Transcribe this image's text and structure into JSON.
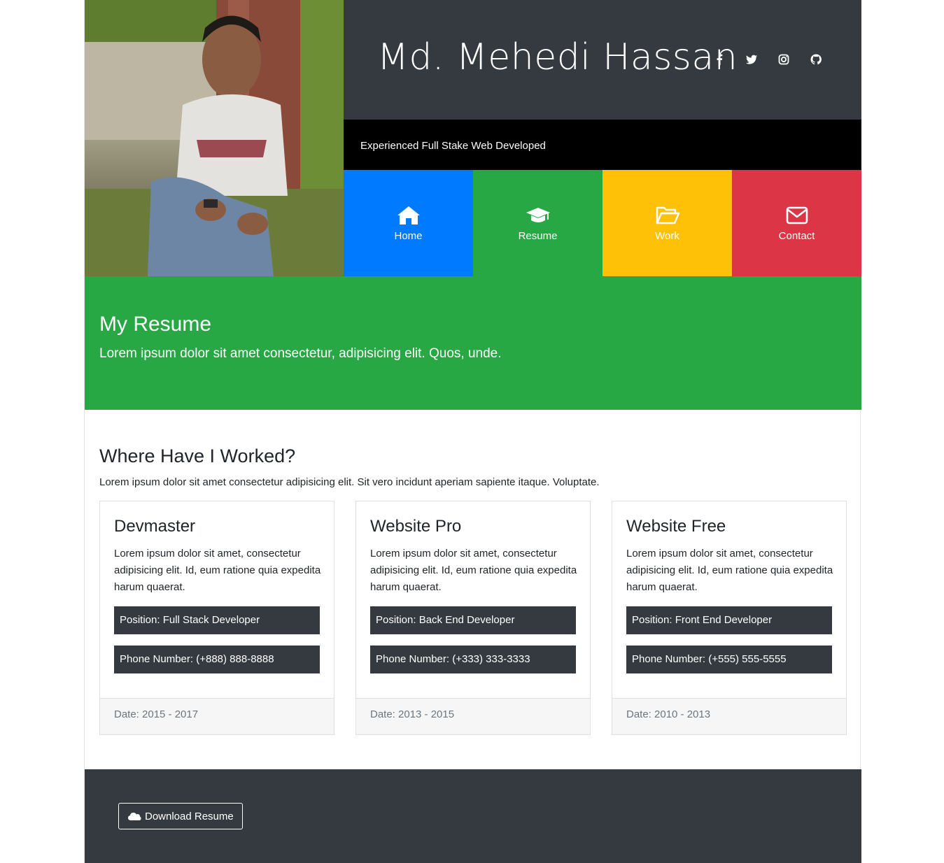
{
  "header": {
    "name": "Md. Mehedi Hassan",
    "tagline": "Experienced Full Stake Web Developed",
    "social": [
      "facebook-icon",
      "twitter-icon",
      "instagram-icon",
      "github-icon"
    ]
  },
  "nav": {
    "items": [
      {
        "label": "Home",
        "icon": "home-icon",
        "color": "#007bff"
      },
      {
        "label": "Resume",
        "icon": "graduation-cap-icon",
        "color": "#28a745"
      },
      {
        "label": "Work",
        "icon": "folder-open-icon",
        "color": "#ffc107"
      },
      {
        "label": "Contact",
        "icon": "envelope-icon",
        "color": "#dc3545"
      }
    ]
  },
  "hero": {
    "title": "My Resume",
    "subtitle": "Lorem ipsum dolor sit amet consectetur, adipisicing elit. Quos, unde."
  },
  "work": {
    "title": "Where Have I Worked?",
    "intro": "Lorem ipsum dolor sit amet consectetur adipisicing elit. Sit vero incidunt aperiam sapiente itaque. Voluptate.",
    "cards": [
      {
        "company": "Devmaster",
        "text": "Lorem ipsum dolor sit amet, consectetur adipisicing elit. Id, eum ratione quia expedita harum quaerat.",
        "position": "Position: Full Stack Developer",
        "phone": "Phone Number: (+888) 888-8888",
        "date": "Date: 2015 - 2017"
      },
      {
        "company": "Website Pro",
        "text": "Lorem ipsum dolor sit amet, consectetur adipisicing elit. Id, eum ratione quia expedita harum quaerat.",
        "position": "Position: Back End Developer",
        "phone": "Phone Number: (+333) 333-3333",
        "date": "Date: 2013 - 2015"
      },
      {
        "company": "Website Free",
        "text": "Lorem ipsum dolor sit amet, consectetur adipisicing elit. Id, eum ratione quia expedita harum quaerat.",
        "position": "Position: Front End Developer",
        "phone": "Phone Number: (+555) 555-5555",
        "date": "Date: 2010 - 2013"
      }
    ]
  },
  "footer": {
    "download_label": "Download Resume",
    "download_icon": "cloud-icon"
  },
  "colors": {
    "dark": "#343a40",
    "black": "#000000",
    "green": "#28a745"
  }
}
